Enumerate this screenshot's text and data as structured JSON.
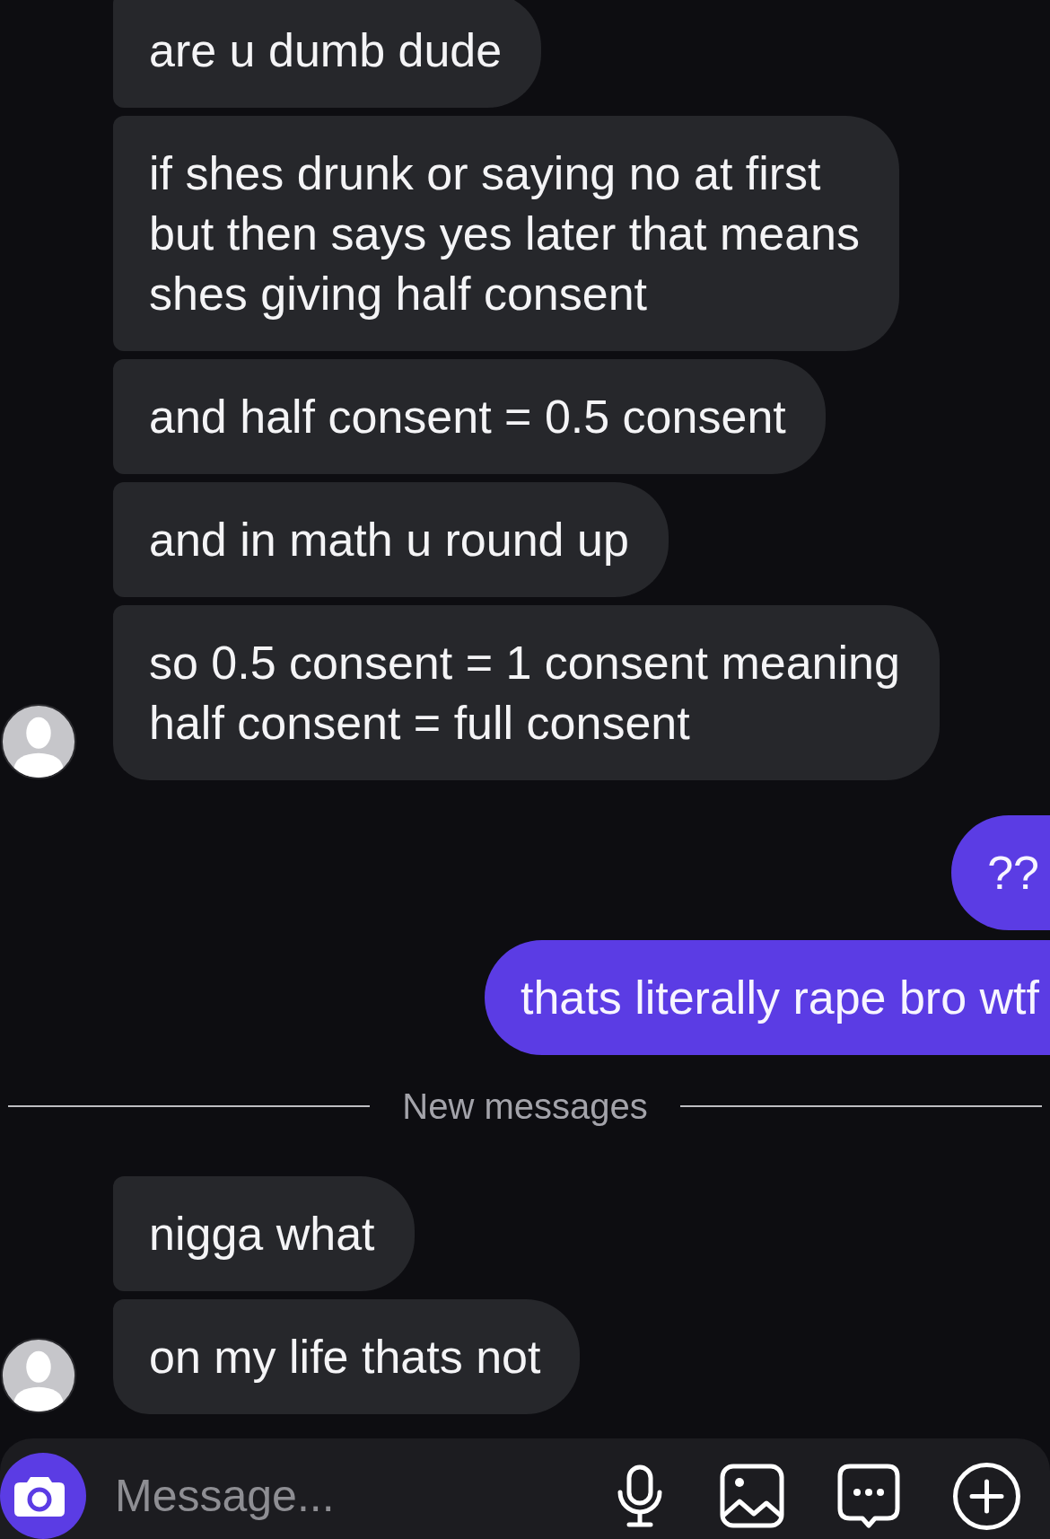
{
  "conversation": [
    {
      "kind": "incoming",
      "messages": [
        "are u dumb dude",
        "if shes drunk or saying no at first\nbut then says yes later that means\nshes giving half consent",
        "and half consent = 0.5 consent",
        "and in math u round up",
        "so 0.5 consent = 1 consent meaning\nhalf consent = full consent"
      ]
    },
    {
      "kind": "outgoing",
      "messages": [
        "??",
        "thats literally rape bro wtf"
      ]
    },
    {
      "kind": "divider",
      "label": "New messages"
    },
    {
      "kind": "incoming",
      "messages": [
        "nigga what",
        "on my life thats not"
      ]
    }
  ],
  "composer": {
    "placeholder": "Message..."
  }
}
